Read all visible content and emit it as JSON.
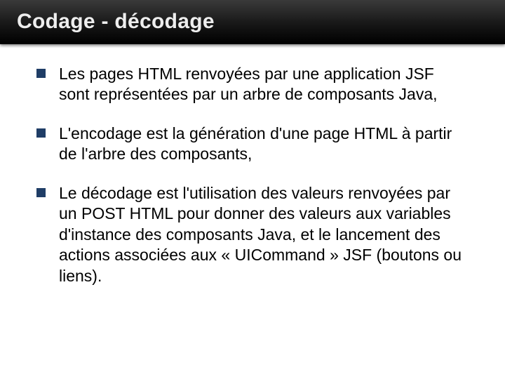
{
  "slide": {
    "title": "Codage - décodage",
    "bullets": [
      "Les pages HTML renvoyées par une application JSF sont représentées par un arbre de composants Java,",
      "L'encodage est la génération d'une page HTML à partir de l'arbre des composants,",
      "Le décodage est l'utilisation des valeurs renvoyées par un POST HTML pour donner des valeurs aux variables d'instance des composants Java, et le lancement des actions associées aux « UICommand » JSF (boutons ou liens)."
    ]
  }
}
